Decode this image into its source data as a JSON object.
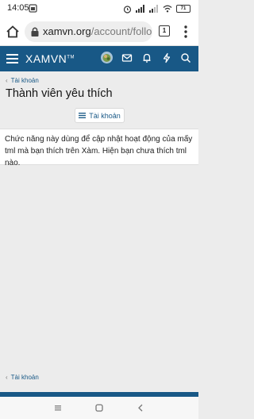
{
  "status_bar": {
    "time": "14:05",
    "battery": "71"
  },
  "browser": {
    "url_domain": "xamvn.org",
    "url_path": "/account/follo",
    "tab_count": "1"
  },
  "site_header": {
    "logo": "XAMVN",
    "logo_mark": "TM"
  },
  "breadcrumb_top": "Tài khoản",
  "page_title": "Thành viên yêu thích",
  "account_button_label": "Tài khoản",
  "notice_text": "Chức năng này dùng để cập nhật hoạt động của mấy tml mà bạn thích trên Xàm. Hiện bạn chưa thích tml nào.",
  "breadcrumb_bottom": "Tài khoản",
  "colors": {
    "brand": "#185886",
    "background": "#ececec"
  }
}
